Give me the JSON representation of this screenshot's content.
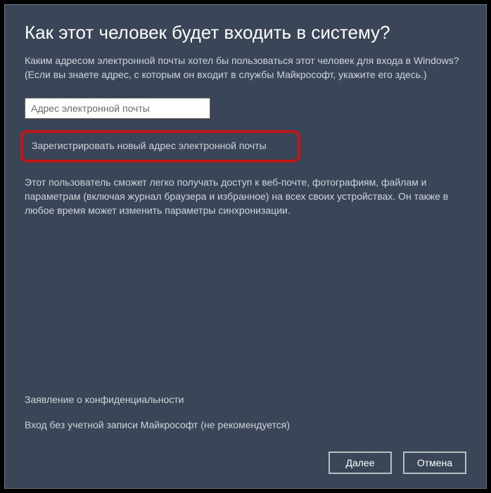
{
  "dialog": {
    "title": "Как этот человек будет входить в систему?",
    "subtitle": "Каким адресом электронной почты хотел бы пользоваться этот человек для входа в Windows? (Если вы знаете адрес, с которым он входит в службы Майкрософт, укажите его здесь.)",
    "email_placeholder": "Адрес электронной почты",
    "register_link": "Зарегистрировать новый адрес электронной почты",
    "info_text": "Этот пользователь сможет легко получать доступ к веб-почте, фотографиям, файлам и параметрам (включая журнал браузера и избранное) на всех своих устройствах. Он также в любое время может изменить параметры синхронизации.",
    "privacy_link": "Заявление о конфиденциальности",
    "no_account_link": "Вход без учетной записи Майкрософт (не рекомендуется)",
    "next_button": "Далее",
    "cancel_button": "Отмена"
  }
}
